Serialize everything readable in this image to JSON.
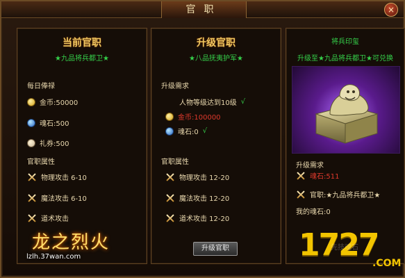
{
  "window": {
    "title": "官职",
    "close_label": "×"
  },
  "current_panel": {
    "title": "当前官职",
    "rank": "★九品将兵都卫★",
    "daily_salary_label": "每日俸禄",
    "rewards": [
      {
        "icon": "gold-coin-icon",
        "text": "金币:50000"
      },
      {
        "icon": "soul-stone-icon",
        "text": "魂石:500"
      },
      {
        "icon": "gift-voucher-icon",
        "text": "礼券:500"
      }
    ],
    "attributes_label": "官职属性",
    "attributes": [
      {
        "icon": "crossed-swords-icon",
        "text": "物理攻击  6-10"
      },
      {
        "icon": "crossed-swords-icon",
        "text": "魔法攻击  6-10"
      },
      {
        "icon": "crossed-swords-icon",
        "text": "道术攻击"
      }
    ]
  },
  "upgrade_panel": {
    "title": "升级官职",
    "rank": "★八品抚夷护军★",
    "requirements_label": "升级需求",
    "requirements": [
      {
        "text": "人物等级达到10级",
        "check": "√"
      },
      {
        "icon": "gold-coin-icon",
        "text": "金币:100000",
        "check": ""
      },
      {
        "icon": "soul-stone-icon",
        "text": "魂石:0",
        "check": "√"
      }
    ],
    "attributes_label": "官职属性",
    "attributes": [
      {
        "icon": "crossed-swords-icon",
        "text": "物理攻击  12-20"
      },
      {
        "icon": "crossed-swords-icon",
        "text": "魔法攻击  12-20"
      },
      {
        "icon": "crossed-swords-icon",
        "text": "道术攻击  12-20"
      }
    ],
    "button_label": "升级官职"
  },
  "seal_panel": {
    "title": "将兵印玺",
    "description": "升级至★九品将兵都卫★可兑换",
    "requirements_label": "升级需求",
    "requirements": [
      {
        "icon": "crossed-swords-icon",
        "text": "魂石:511"
      },
      {
        "icon": "crossed-swords-icon",
        "text": "官职:★九品将兵都卫★"
      }
    ],
    "my_soul_stone": "我的魂石:0"
  },
  "watermarks": {
    "left_brand": "龙之烈火",
    "left_url": "lzlh.37wan.com",
    "right_mark": "1727",
    "right_sub": ".COM",
    "right_faint": "先技魂石"
  },
  "colors": {
    "green": "#35d04a",
    "red": "#e0392c",
    "gold": "#f0c860"
  }
}
